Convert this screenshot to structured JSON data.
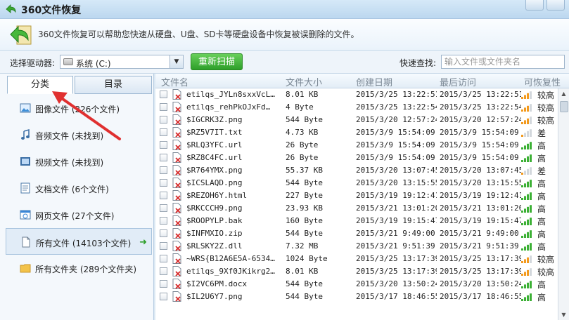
{
  "window": {
    "title": "360文件恢复"
  },
  "banner": {
    "description": "360文件恢复可以帮助您快速从硬盘、U盘、SD卡等硬盘设备中恢复被误删除的文件。"
  },
  "toolbar": {
    "drive_label": "选择驱动器:",
    "drive_value": "系统 (C:)",
    "scan_button": "重新扫描",
    "quick_search_label": "快速查找:",
    "search_placeholder": "输入文件或文件夹名"
  },
  "left": {
    "tabs": [
      {
        "label": "分类"
      },
      {
        "label": "目录"
      }
    ],
    "categories": [
      {
        "label": "图像文件 (226个文件)",
        "icon": "image-icon"
      },
      {
        "label": "音频文件 (未找到)",
        "icon": "music-icon"
      },
      {
        "label": "视频文件 (未找到)",
        "icon": "video-icon"
      },
      {
        "label": "文档文件 (6个文件)",
        "icon": "document-icon"
      },
      {
        "label": "网页文件 (27个文件)",
        "icon": "web-icon"
      },
      {
        "label": "所有文件 (14103个文件)",
        "icon": "file-icon"
      },
      {
        "label": "所有文件夹 (289个文件夹)",
        "icon": "folder-icon"
      }
    ],
    "active_index": 5
  },
  "table": {
    "headers": [
      "文件名",
      "文件大小",
      "创建日期",
      "最后访问",
      "可恢复性"
    ],
    "rows": [
      {
        "name": "etilqs_JYLn8sxxVcL…",
        "size": "8.01 KB",
        "created": "2015/3/25 13:22:51",
        "access": "2015/3/25 13:22:51",
        "recover": "较高",
        "level": 3
      },
      {
        "name": "etilqs_rehPkOJxFd…",
        "size": "4 Byte",
        "created": "2015/3/25 13:22:54",
        "access": "2015/3/25 13:22:54",
        "recover": "较高",
        "level": 3
      },
      {
        "name": "$IGCRK3Z.png",
        "size": "544 Byte",
        "created": "2015/3/20 12:57:24",
        "access": "2015/3/20 12:57:24",
        "recover": "较高",
        "level": 3
      },
      {
        "name": "$RZ5V7IT.txt",
        "size": "4.73 KB",
        "created": "2015/3/9 15:54:09",
        "access": "2015/3/9 15:54:09",
        "recover": "差",
        "level": 1
      },
      {
        "name": "$RLQ3YFC.url",
        "size": "26 Byte",
        "created": "2015/3/9 15:54:09",
        "access": "2015/3/9 15:54:09",
        "recover": "高",
        "level": 4
      },
      {
        "name": "$RZ8C4FC.url",
        "size": "26 Byte",
        "created": "2015/3/9 15:54:09",
        "access": "2015/3/9 15:54:09",
        "recover": "高",
        "level": 4
      },
      {
        "name": "$R764YMX.png",
        "size": "55.37 KB",
        "created": "2015/3/20 13:07:45",
        "access": "2015/3/20 13:07:45",
        "recover": "差",
        "level": 1
      },
      {
        "name": "$ICSLAQD.png",
        "size": "544 Byte",
        "created": "2015/3/20 13:15:55",
        "access": "2015/3/20 13:15:55",
        "recover": "高",
        "level": 4
      },
      {
        "name": "$REZOH6Y.html",
        "size": "227 Byte",
        "created": "2015/3/19 19:12:41",
        "access": "2015/3/19 19:12:41",
        "recover": "高",
        "level": 4
      },
      {
        "name": "$RKCCCH9.png",
        "size": "23.93 KB",
        "created": "2015/3/21 13:01:20",
        "access": "2015/3/21 13:01:20",
        "recover": "高",
        "level": 4
      },
      {
        "name": "$ROOPYLP.bak",
        "size": "160 Byte",
        "created": "2015/3/19 19:15:47",
        "access": "2015/3/19 19:15:47",
        "recover": "高",
        "level": 4
      },
      {
        "name": "$INFMXIO.zip",
        "size": "544 Byte",
        "created": "2015/3/21 9:49:00",
        "access": "2015/3/21 9:49:00",
        "recover": "高",
        "level": 4
      },
      {
        "name": "$RLSKY2Z.dll",
        "size": "7.32 MB",
        "created": "2015/3/21 9:51:39",
        "access": "2015/3/21 9:51:39",
        "recover": "高",
        "level": 4
      },
      {
        "name": "~WRS{B12A6E5A-6534…",
        "size": "1024 Byte",
        "created": "2015/3/25 13:17:39",
        "access": "2015/3/25 13:17:39",
        "recover": "较高",
        "level": 3
      },
      {
        "name": "etilqs_9Xf0JKikrg2…",
        "size": "8.01 KB",
        "created": "2015/3/25 13:17:39",
        "access": "2015/3/25 13:17:39",
        "recover": "较高",
        "level": 3
      },
      {
        "name": "$I2VC6PM.docx",
        "size": "544 Byte",
        "created": "2015/3/20 13:50:24",
        "access": "2015/3/20 13:50:24",
        "recover": "高",
        "level": 4
      },
      {
        "name": "$IL2U6Y7.png",
        "size": "544 Byte",
        "created": "2015/3/17 18:46:55",
        "access": "2015/3/17 18:46:55",
        "recover": "高",
        "level": 4
      }
    ]
  },
  "colors": {
    "accent_green": "#2e9f2a",
    "signal_orange": "#f39a1e",
    "signal_green": "#3cb035",
    "annotation_red": "#e03030"
  }
}
